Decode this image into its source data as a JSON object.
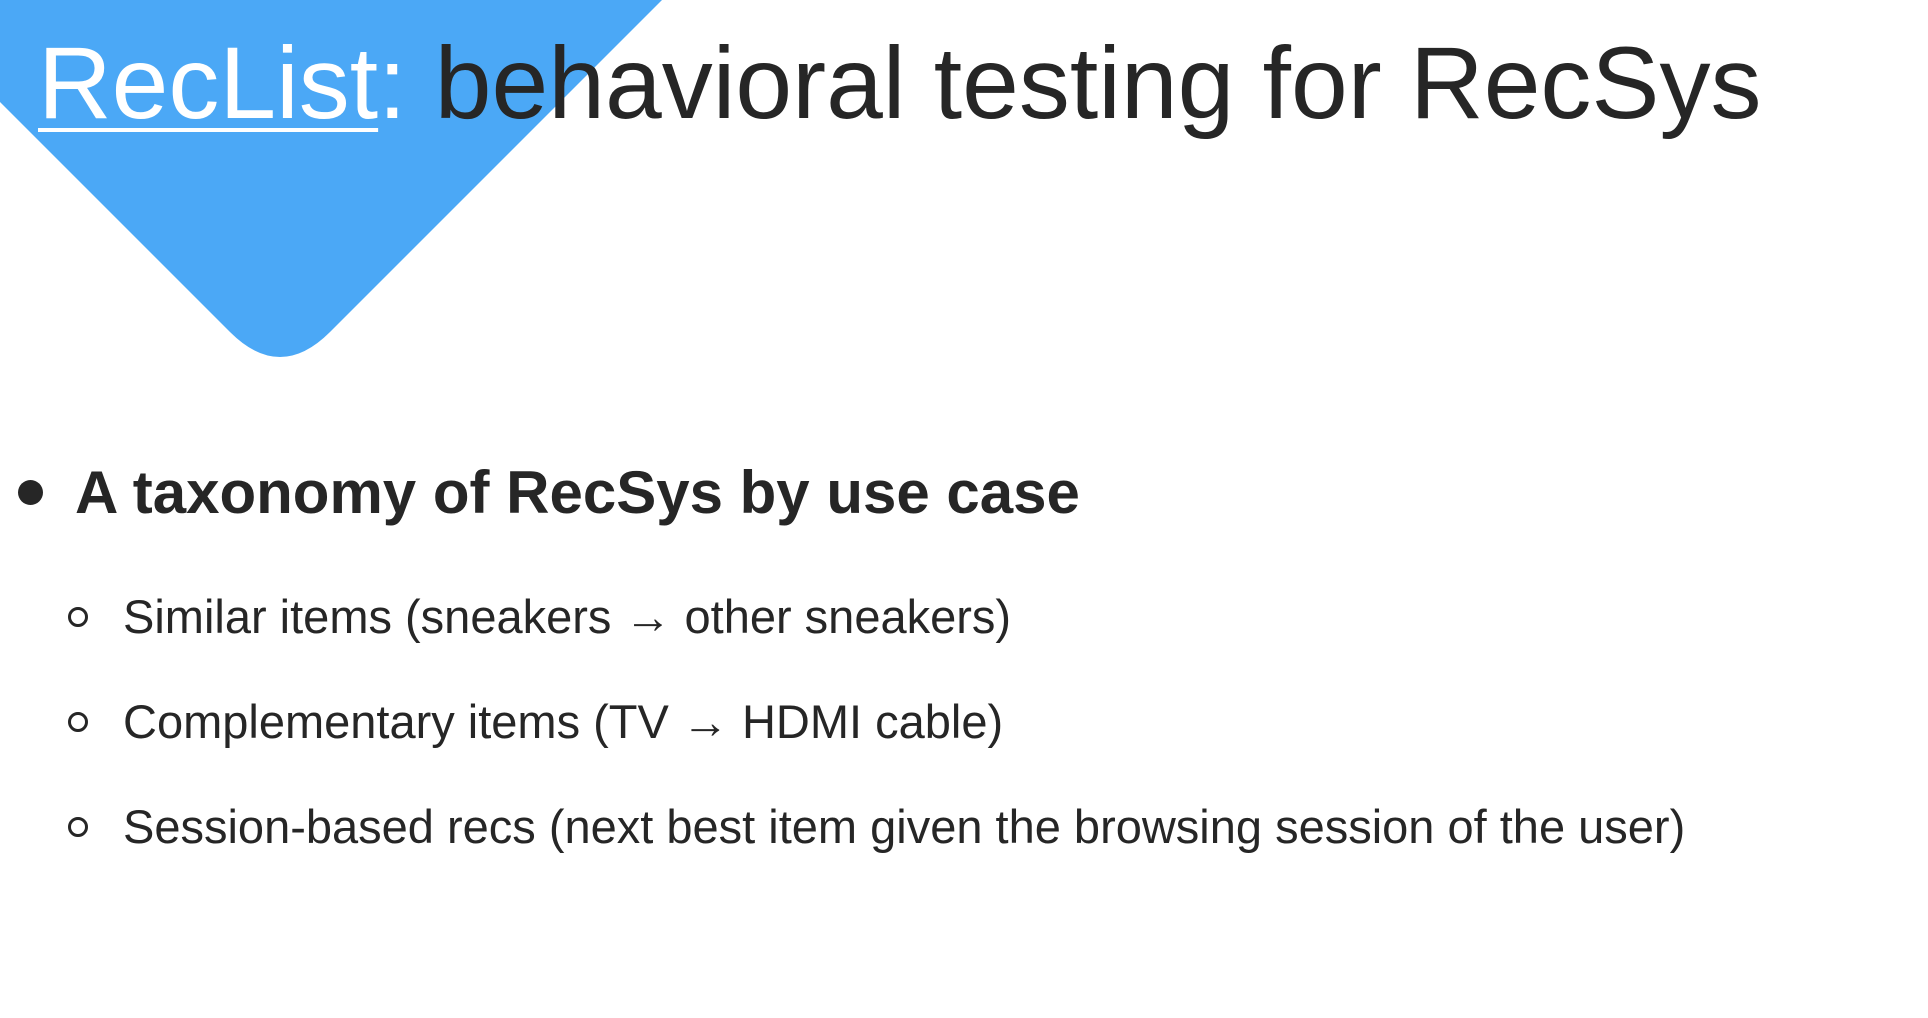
{
  "title": {
    "link_text": "RecList",
    "colon": ":",
    "rest": " behavioral testing for RecSys"
  },
  "main_bullet": "A taxonomy of RecSys by use case",
  "sub_bullets": [
    "Similar items (sneakers → other sneakers)",
    "Complementary items (TV → HDMI cable)",
    "Session-based recs (next best item given the browsing session of the user)"
  ],
  "colors": {
    "accent": "#4BA8F6",
    "text": "#262626",
    "background": "#ffffff"
  },
  "icons": {
    "main_bullet": "filled-circle-bullet-icon",
    "sub_bullet": "hollow-circle-bullet-icon"
  }
}
